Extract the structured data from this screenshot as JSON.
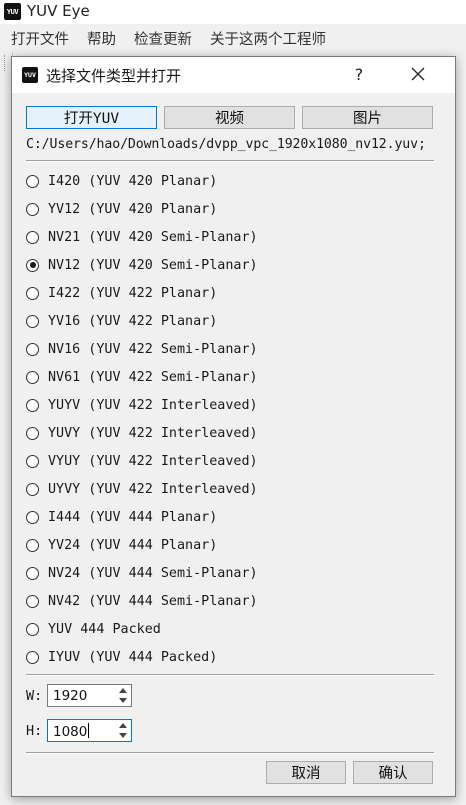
{
  "app": {
    "title": "YUV Eye",
    "logo_text": "YUV"
  },
  "menubar": {
    "items": [
      "打开文件",
      "帮助",
      "检查更新",
      "关于这两个工程师"
    ]
  },
  "dialog": {
    "title": "选择文件类型并打开",
    "help_label": "?",
    "tabs": [
      {
        "label": "打开YUV",
        "active": true
      },
      {
        "label": "视频",
        "active": false
      },
      {
        "label": "图片",
        "active": false
      }
    ],
    "file_path": "C:/Users/hao/Downloads/dvpp_vpc_1920x1080_nv12.yuv;",
    "formats": [
      {
        "label": "I420 (YUV 420 Planar)",
        "checked": false
      },
      {
        "label": "YV12 (YUV 420 Planar)",
        "checked": false
      },
      {
        "label": "NV21 (YUV 420 Semi-Planar)",
        "checked": false
      },
      {
        "label": "NV12 (YUV 420 Semi-Planar)",
        "checked": true
      },
      {
        "label": "I422 (YUV 422 Planar)",
        "checked": false
      },
      {
        "label": "YV16 (YUV 422 Planar)",
        "checked": false
      },
      {
        "label": "NV16 (YUV 422 Semi-Planar)",
        "checked": false
      },
      {
        "label": "NV61 (YUV 422 Semi-Planar)",
        "checked": false
      },
      {
        "label": "YUYV (YUV 422 Interleaved)",
        "checked": false
      },
      {
        "label": "YUVY (YUV 422 Interleaved)",
        "checked": false
      },
      {
        "label": "VYUY (YUV 422 Interleaved)",
        "checked": false
      },
      {
        "label": "UYVY (YUV 422 Interleaved)",
        "checked": false
      },
      {
        "label": "I444 (YUV 444 Planar)",
        "checked": false
      },
      {
        "label": "YV24 (YUV 444 Planar)",
        "checked": false
      },
      {
        "label": "NV24 (YUV 444 Semi-Planar)",
        "checked": false
      },
      {
        "label": "NV42 (YUV 444 Semi-Planar)",
        "checked": false
      },
      {
        "label": "YUV 444 Packed",
        "checked": false
      },
      {
        "label": "IYUV (YUV 444 Packed)",
        "checked": false
      }
    ],
    "width": {
      "label": "W:",
      "value": "1920"
    },
    "height": {
      "label": "H:",
      "value": "1080"
    },
    "cancel_label": "取消",
    "ok_label": "确认"
  }
}
